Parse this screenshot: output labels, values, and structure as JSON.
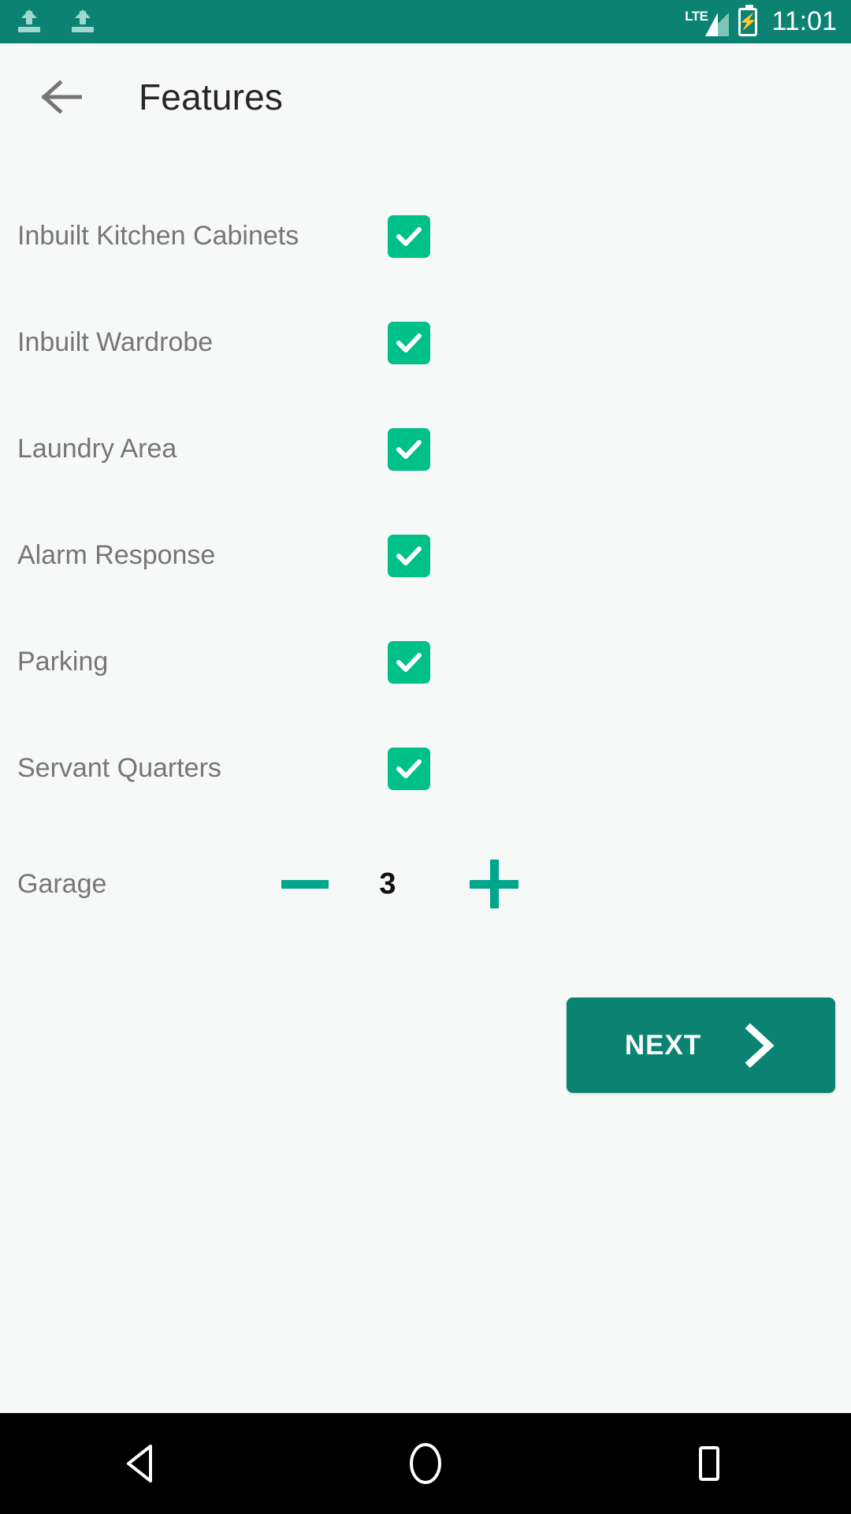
{
  "status_bar": {
    "background": "#0b8272",
    "left_icons": [
      "upload-icon",
      "upload-icon"
    ],
    "network_label": "LTE",
    "signal_icon": "signal-bars-icon",
    "battery_icon": "battery-charging-icon",
    "time": "11:01"
  },
  "app_bar": {
    "back_icon": "arrow-left-icon",
    "title": "Features",
    "title_color": "#262626",
    "background": "#f7f8f8"
  },
  "features": {
    "checkbox_color": "#00c089",
    "items": [
      {
        "label": "Inbuilt Kitchen Cabinets",
        "checked": true
      },
      {
        "label": "Inbuilt Wardrobe",
        "checked": true
      },
      {
        "label": "Laundry Area",
        "checked": true
      },
      {
        "label": "Alarm Response",
        "checked": true
      },
      {
        "label": "Parking",
        "checked": true
      },
      {
        "label": "Servant Quarters",
        "checked": true
      }
    ]
  },
  "stepper": {
    "label": "Garage",
    "value": "3",
    "decrement_icon": "minus-icon",
    "increment_icon": "plus-icon",
    "accent_color": "#00a58c"
  },
  "next_button": {
    "label": "NEXT",
    "icon": "chevron-right-icon",
    "background": "#0b8272",
    "text_color": "#ffffff"
  },
  "nav_bar": {
    "background": "#000000",
    "buttons": [
      {
        "name": "back-triangle-icon"
      },
      {
        "name": "home-circle-icon"
      },
      {
        "name": "recents-square-icon"
      }
    ]
  }
}
